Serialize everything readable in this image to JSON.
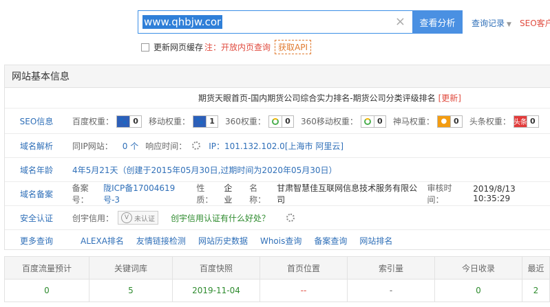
{
  "search": {
    "value": "www.qhbjw.com/",
    "clear_icon": "×",
    "analyze_label": "查看分析",
    "history_label": "查询记录",
    "history_caret": "▼",
    "seo_client_label": "SEO客户"
  },
  "cache": {
    "label": "更新网页缓存",
    "note": "注：开放内页查询",
    "api_label": "获取API"
  },
  "panel": {
    "header": "网站基本信息",
    "site_title": "期货天眼首页-国内期货公司综合实力排名-期货公司分类评级排名",
    "update_label": "[更新]"
  },
  "seo": {
    "label": "SEO信息",
    "items": [
      {
        "name": "百度权重：",
        "value": "0"
      },
      {
        "name": "移动权重：",
        "value": "1"
      },
      {
        "name": "360权重：",
        "value": "0"
      },
      {
        "name": "360移动权重：",
        "value": "0"
      },
      {
        "name": "神马权重：",
        "value": "0"
      },
      {
        "name": "头条权重：",
        "value": "0"
      }
    ],
    "toutiao_icon_text": "头条"
  },
  "dns": {
    "label": "域名解析",
    "same_ip_label": "同IP网站：",
    "same_ip_value": "0 个",
    "response_label": "响应时间：",
    "ip_text": "IP：101.132.102.0[上海市 阿里云]"
  },
  "age": {
    "label": "域名年龄",
    "value": "4年5月21天（创建于2015年05月30日,过期时间为2020年05月30日）"
  },
  "icp": {
    "label": "域名备案",
    "no_label": "备案号：",
    "no_value": "陇ICP备17004619号-3",
    "type_label": "性质：",
    "type_value": "企业",
    "name_label": "名称：",
    "name_value": "甘肃智慧佳互联网信息技术服务有限公司",
    "time_label": "审核时间：",
    "time_value": "2019/8/13 10:35:29"
  },
  "security": {
    "label": "安全认证",
    "credit_label": "创宇信用：",
    "badge_text": "未认证",
    "benefit_link": "创宇信用认证有什么好处？"
  },
  "more": {
    "label": "更多查询",
    "links": [
      "ALEXA排名",
      "友情链接检测",
      "网站历史数据",
      "Whois查询",
      "备案查询",
      "网站排名"
    ]
  },
  "stats": {
    "headers": [
      "百度流量预计",
      "关键词库",
      "百度快照",
      "首页位置",
      "索引量",
      "今日收录",
      "最近"
    ],
    "values": [
      "0",
      "5",
      "2019-11-04",
      "--",
      "-",
      "0",
      "2"
    ]
  },
  "colors": {
    "accent": "#4a90e2",
    "link": "#2f6fb8",
    "red": "#e04b3f",
    "green": "#2e8b2e"
  }
}
